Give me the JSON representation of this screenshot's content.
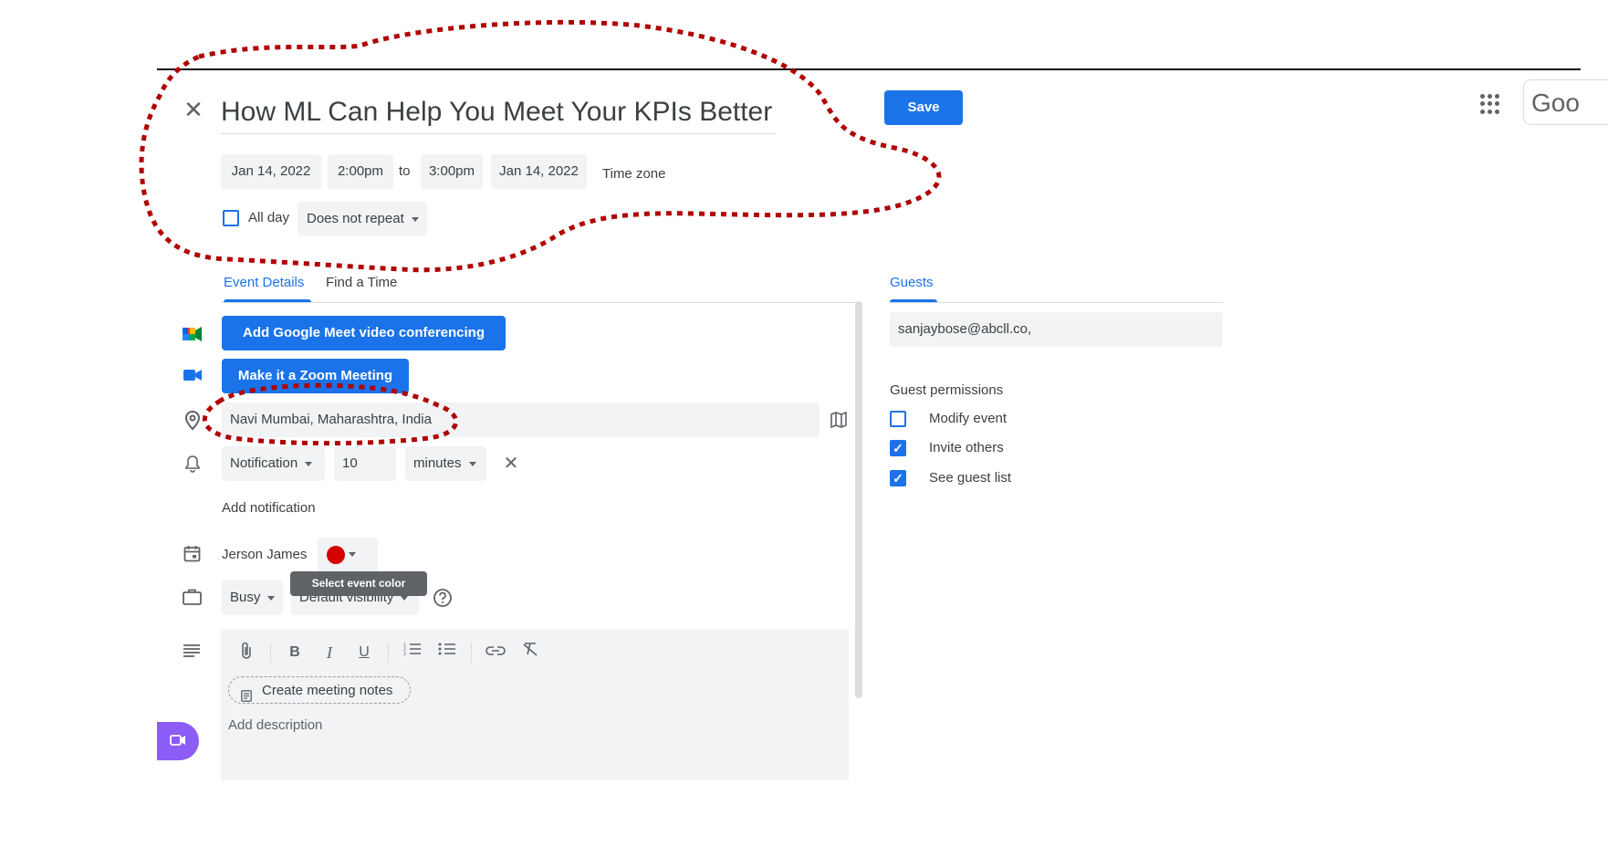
{
  "event": {
    "title": "How ML Can Help You Meet Your KPIs Better",
    "save_label": "Save",
    "google_partial": "Goo"
  },
  "datetime": {
    "start_date": "Jan 14, 2022",
    "start_time": "2:00pm",
    "to_label": "to",
    "end_time": "3:00pm",
    "end_date": "Jan 14, 2022",
    "time_zone_label": "Time zone",
    "all_day_label": "All day",
    "repeat_value": "Does not repeat"
  },
  "tabs": [
    {
      "label": "Event Details",
      "active": true
    },
    {
      "label": "Find a Time",
      "active": false
    }
  ],
  "details": {
    "meet_button": "Add Google Meet video conferencing",
    "zoom_button": "Make it a Zoom Meeting",
    "location_value": "Navi Mumbai, Maharashtra, India",
    "notification_type": "Notification",
    "notification_amount": "10",
    "notification_unit": "minutes",
    "add_notification": "Add notification",
    "calendar_owner": "Jerson James",
    "event_color_tooltip": "Select event color",
    "event_color": "#d50000",
    "availability": "Busy",
    "visibility_partial": "Default visibility",
    "create_notes": "Create meeting notes",
    "description_placeholder": "Add description"
  },
  "guests": {
    "tab_label": "Guests",
    "input_value": "sanjaybose@abcll.co,",
    "permissions_title": "Guest permissions",
    "permissions": [
      {
        "label": "Modify event",
        "checked": false
      },
      {
        "label": "Invite others",
        "checked": true
      },
      {
        "label": "See guest list",
        "checked": true
      }
    ]
  },
  "colors": {
    "accent": "#1a73e8",
    "annotation": "#b00000"
  }
}
